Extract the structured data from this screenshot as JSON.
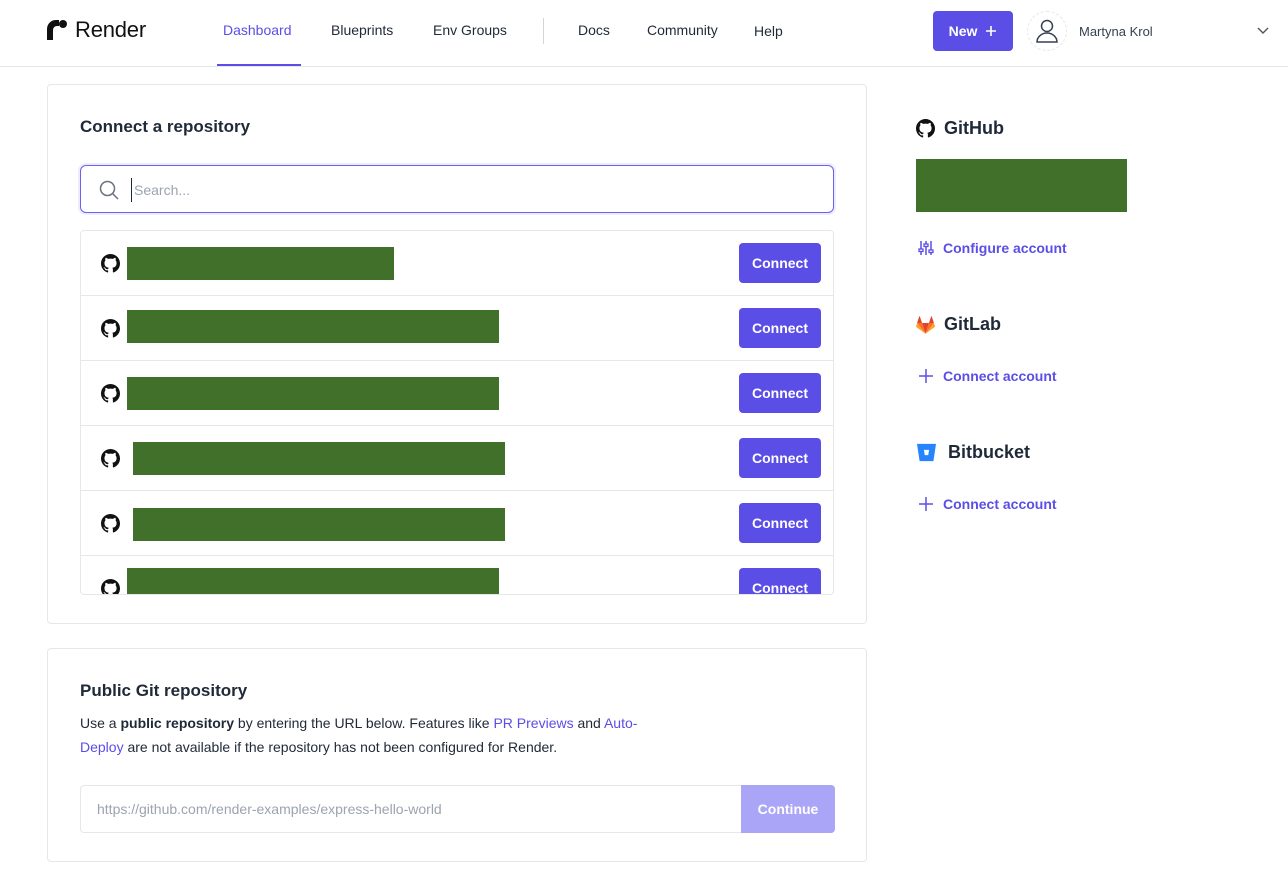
{
  "header": {
    "brand": "Render",
    "nav": [
      {
        "label": "Dashboard",
        "active": true
      },
      {
        "label": "Blueprints"
      },
      {
        "label": "Env Groups"
      },
      {
        "label": "Docs"
      },
      {
        "label": "Community"
      },
      {
        "label": "Help"
      }
    ],
    "new_label": "New",
    "user_name": "Martyna Krol"
  },
  "connect_repo": {
    "title": "Connect a repository",
    "search_placeholder": "Search...",
    "connect_label": "Connect",
    "rows": [
      {
        "redacted": true
      },
      {
        "redacted": true
      },
      {
        "redacted": true
      },
      {
        "redacted": true
      },
      {
        "redacted": true
      },
      {
        "redacted": true
      }
    ]
  },
  "public_repo": {
    "title": "Public Git repository",
    "desc_1": "Use a ",
    "desc_bold": "public repository",
    "desc_2": " by entering the URL below. Features like ",
    "link_pr": "PR Previews",
    "desc_3": " and ",
    "link_auto_1": "Auto-",
    "link_auto_2": "Deploy",
    "desc_4": " are not available if the repository has not been configured for Render.",
    "url_placeholder": "https://github.com/render-examples/express-hello-world",
    "continue_label": "Continue"
  },
  "providers": {
    "github": {
      "name": "GitHub",
      "action": "Configure account"
    },
    "gitlab": {
      "name": "GitLab",
      "action": "Connect account"
    },
    "bitbucket": {
      "name": "Bitbucket",
      "action": "Connect account"
    }
  },
  "colors": {
    "accent": "#5b4ee6",
    "redaction": "#41702b",
    "continue_disabled": "#aaa5f7"
  }
}
